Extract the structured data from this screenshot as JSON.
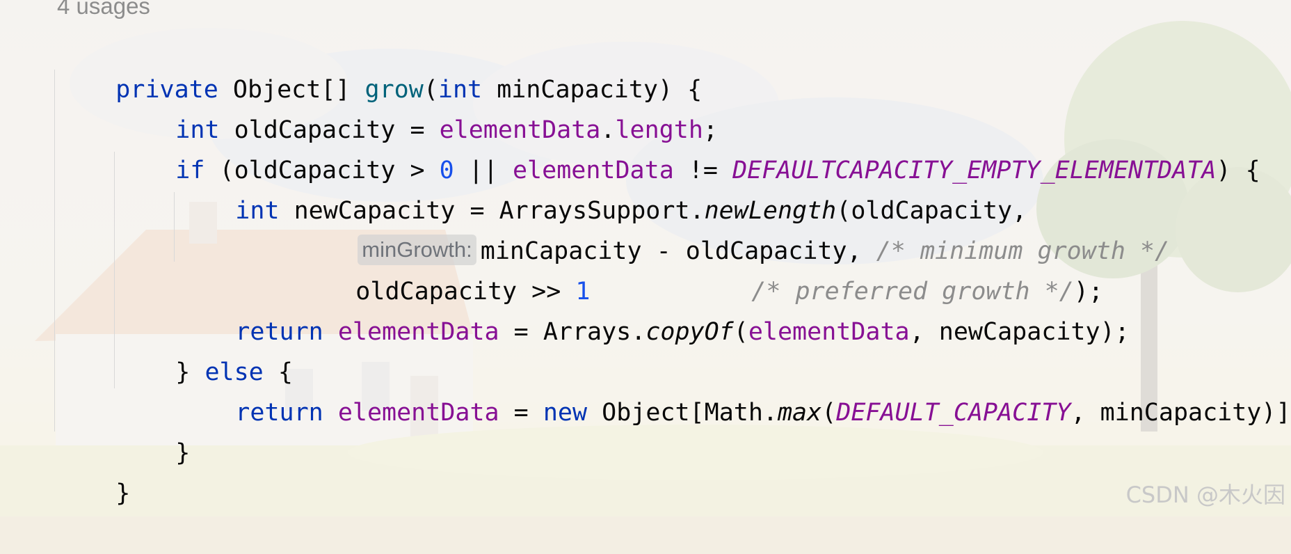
{
  "editor": {
    "usages_label": "4 usages",
    "param_hint": "minGrowth:",
    "lines": {
      "l1": {
        "t0": "private",
        "t1": " Object[] ",
        "t2": "grow",
        "t3": "(",
        "t4": "int",
        "t5": " minCapacity) {"
      },
      "l2": {
        "t0": "int",
        "t1": " oldCapacity = ",
        "t2": "elementData",
        "t3": ".",
        "t4": "length",
        "t5": ";"
      },
      "l3": {
        "t0": "if",
        "t1": " (oldCapacity > ",
        "t2": "0",
        "t3": " || ",
        "t4": "elementData",
        "t5": " != ",
        "t6": "DEFAULTCAPACITY_EMPTY_ELEMENTDATA",
        "t7": ") {"
      },
      "l4": {
        "t0": "int",
        "t1": " newCapacity = ArraysSupport.",
        "t2": "newLength",
        "t3": "(oldCapacity,"
      },
      "l5": {
        "t1": "minCapacity - oldCapacity, ",
        "t2": "/* minimum growth */"
      },
      "l6": {
        "t0": "oldCapacity >> ",
        "t1": "1",
        "t2": "           ",
        "t3": "/* preferred growth */",
        "t4": ");"
      },
      "l7": {
        "t0": "return",
        "t1": " ",
        "t2": "elementData",
        "t3": " = Arrays.",
        "t4": "copyOf",
        "t5": "(",
        "t6": "elementData",
        "t7": ", newCapacity);"
      },
      "l8": {
        "t0": "} ",
        "t1": "else",
        "t2": " {"
      },
      "l9": {
        "t0": "return",
        "t1": " ",
        "t2": "elementData",
        "t3": " = ",
        "t4": "new",
        "t5": " Object[Math.",
        "t6": "max",
        "t7": "(",
        "t8": "DEFAULT_CAPACITY",
        "t9": ", minCapacity)];"
      },
      "l10": {
        "t0": "}"
      },
      "l11": {
        "t0": "}"
      }
    }
  },
  "watermark": "CSDN @木火因",
  "colors": {
    "keyword": "#0033b3",
    "field": "#871094",
    "method": "#00627a",
    "number": "#1750eb",
    "comment": "#8c8c8c"
  }
}
